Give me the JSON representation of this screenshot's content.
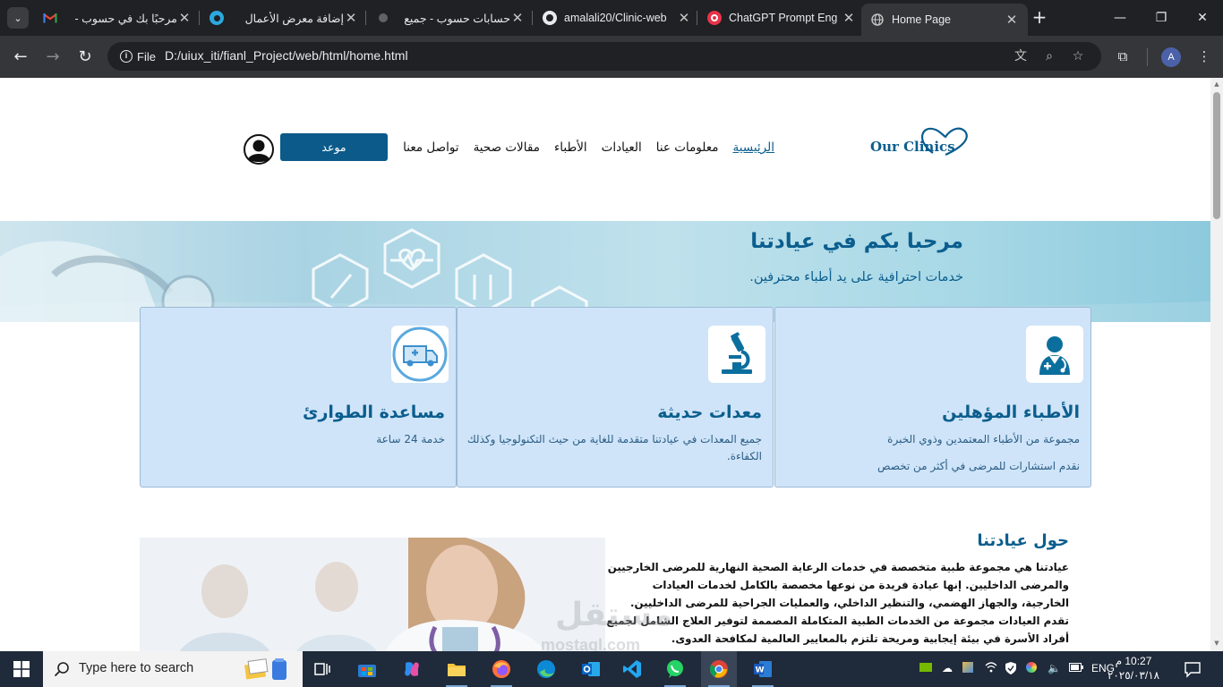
{
  "browser": {
    "tabs": [
      {
        "title": "مرحبًا بك في حسوب -",
        "icon": "gmail-icon"
      },
      {
        "title": "إضافة معرض الأعمال",
        "icon": "mostaql-icon"
      },
      {
        "title": "حسابات حسوب - جميع",
        "icon": "hsoub-icon"
      },
      {
        "title": "amalali20/Clinic-web",
        "icon": "github-icon"
      },
      {
        "title": "ChatGPT Prompt Eng",
        "icon": "deeplearning-icon"
      },
      {
        "title": "Home Page",
        "icon": "globe-icon",
        "active": true
      }
    ],
    "info_chip": "File",
    "url": "D:/uiux_iti/fianl_Project/web/html/home.html",
    "profile_initial": "A"
  },
  "site": {
    "logo_text": "Our Clinics",
    "nav": [
      "الرئيسية",
      "معلومات عنا",
      "العيادات",
      "الأطباء",
      "مقالات صحية",
      "تواصل معنا"
    ],
    "appointment_label": "موعد",
    "hero": {
      "title": "مرحبا بكم في عيادتنا",
      "subtitle": "خدمات احترافية على يد أطباء محترفين."
    },
    "cards": [
      {
        "title": "الأطباء المؤهلين",
        "text": "مجموعة من الأطباء المعتمدين وذوي الخبرة",
        "text2": "نقدم استشارات للمرضى في أكثر من تخصص",
        "icon": "doctor-icon"
      },
      {
        "title": "معدات حديثة",
        "text": "جميع المعدات في عيادتنا متقدمة للغاية من حيث التكنولوجيا وكذلك الكفاءة.",
        "text2": "",
        "icon": "microscope-icon"
      },
      {
        "title": "مساعدة الطوارئ",
        "text": "خدمة 24 ساعة",
        "text2": "",
        "icon": "ambulance-icon"
      }
    ],
    "about": {
      "title": "حول عيادتنا",
      "text": "عيادتنا هي مجموعة طبية متخصصة في خدمات الرعاية الصحية النهارية للمرضى الخارجيين والمرضى الداخليين. إنها عيادة فريدة من نوعها مخصصة بالكامل لخدمات العيادات الخارجية، والجهاز الهضمي، والتنظير الداخلي، والعمليات الجراحية للمرضى الداخليين. تقدم العيادات مجموعة من الخدمات الطبية المتكاملة المصممة لتوفير العلاج الشامل لجميع أفراد الأسرة في بيئة إيجابية ومريحة تلتزم بالمعايير العالمية لمكافحة العدوى."
    },
    "watermark": {
      "arabic": "مستقل",
      "latin": "mostaql.com"
    }
  },
  "taskbar": {
    "search_placeholder": "Type here to search",
    "language": "ENG",
    "time": "10:27 م",
    "date": "٢٠٢٥/٠٣/١٨",
    "pinned": [
      "task-view-icon",
      "store-icon",
      "copilot-icon",
      "file-explorer-icon",
      "firefox-icon",
      "edge-icon",
      "outlook-icon",
      "vscode-icon",
      "whatsapp-icon",
      "chrome-icon",
      "word-icon"
    ]
  },
  "colors": {
    "brand": "#0b5e8e",
    "card_bg": "#cfe4f8",
    "chrome_dark": "#202124",
    "taskbar": "#1f2a3a"
  }
}
